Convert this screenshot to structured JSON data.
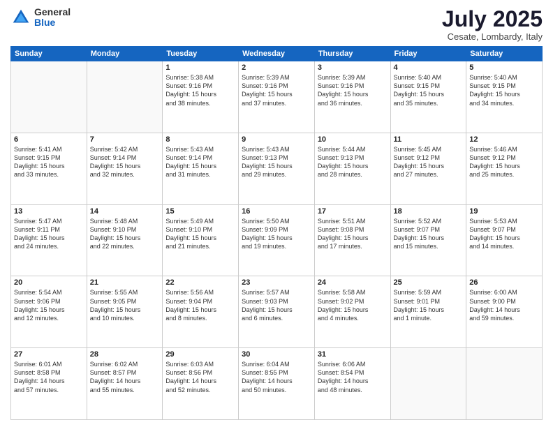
{
  "logo": {
    "general": "General",
    "blue": "Blue"
  },
  "header": {
    "month": "July 2025",
    "location": "Cesate, Lombardy, Italy"
  },
  "weekdays": [
    "Sunday",
    "Monday",
    "Tuesday",
    "Wednesday",
    "Thursday",
    "Friday",
    "Saturday"
  ],
  "weeks": [
    [
      {
        "day": "",
        "info": ""
      },
      {
        "day": "",
        "info": ""
      },
      {
        "day": "1",
        "info": "Sunrise: 5:38 AM\nSunset: 9:16 PM\nDaylight: 15 hours\nand 38 minutes."
      },
      {
        "day": "2",
        "info": "Sunrise: 5:39 AM\nSunset: 9:16 PM\nDaylight: 15 hours\nand 37 minutes."
      },
      {
        "day": "3",
        "info": "Sunrise: 5:39 AM\nSunset: 9:16 PM\nDaylight: 15 hours\nand 36 minutes."
      },
      {
        "day": "4",
        "info": "Sunrise: 5:40 AM\nSunset: 9:15 PM\nDaylight: 15 hours\nand 35 minutes."
      },
      {
        "day": "5",
        "info": "Sunrise: 5:40 AM\nSunset: 9:15 PM\nDaylight: 15 hours\nand 34 minutes."
      }
    ],
    [
      {
        "day": "6",
        "info": "Sunrise: 5:41 AM\nSunset: 9:15 PM\nDaylight: 15 hours\nand 33 minutes."
      },
      {
        "day": "7",
        "info": "Sunrise: 5:42 AM\nSunset: 9:14 PM\nDaylight: 15 hours\nand 32 minutes."
      },
      {
        "day": "8",
        "info": "Sunrise: 5:43 AM\nSunset: 9:14 PM\nDaylight: 15 hours\nand 31 minutes."
      },
      {
        "day": "9",
        "info": "Sunrise: 5:43 AM\nSunset: 9:13 PM\nDaylight: 15 hours\nand 29 minutes."
      },
      {
        "day": "10",
        "info": "Sunrise: 5:44 AM\nSunset: 9:13 PM\nDaylight: 15 hours\nand 28 minutes."
      },
      {
        "day": "11",
        "info": "Sunrise: 5:45 AM\nSunset: 9:12 PM\nDaylight: 15 hours\nand 27 minutes."
      },
      {
        "day": "12",
        "info": "Sunrise: 5:46 AM\nSunset: 9:12 PM\nDaylight: 15 hours\nand 25 minutes."
      }
    ],
    [
      {
        "day": "13",
        "info": "Sunrise: 5:47 AM\nSunset: 9:11 PM\nDaylight: 15 hours\nand 24 minutes."
      },
      {
        "day": "14",
        "info": "Sunrise: 5:48 AM\nSunset: 9:10 PM\nDaylight: 15 hours\nand 22 minutes."
      },
      {
        "day": "15",
        "info": "Sunrise: 5:49 AM\nSunset: 9:10 PM\nDaylight: 15 hours\nand 21 minutes."
      },
      {
        "day": "16",
        "info": "Sunrise: 5:50 AM\nSunset: 9:09 PM\nDaylight: 15 hours\nand 19 minutes."
      },
      {
        "day": "17",
        "info": "Sunrise: 5:51 AM\nSunset: 9:08 PM\nDaylight: 15 hours\nand 17 minutes."
      },
      {
        "day": "18",
        "info": "Sunrise: 5:52 AM\nSunset: 9:07 PM\nDaylight: 15 hours\nand 15 minutes."
      },
      {
        "day": "19",
        "info": "Sunrise: 5:53 AM\nSunset: 9:07 PM\nDaylight: 15 hours\nand 14 minutes."
      }
    ],
    [
      {
        "day": "20",
        "info": "Sunrise: 5:54 AM\nSunset: 9:06 PM\nDaylight: 15 hours\nand 12 minutes."
      },
      {
        "day": "21",
        "info": "Sunrise: 5:55 AM\nSunset: 9:05 PM\nDaylight: 15 hours\nand 10 minutes."
      },
      {
        "day": "22",
        "info": "Sunrise: 5:56 AM\nSunset: 9:04 PM\nDaylight: 15 hours\nand 8 minutes."
      },
      {
        "day": "23",
        "info": "Sunrise: 5:57 AM\nSunset: 9:03 PM\nDaylight: 15 hours\nand 6 minutes."
      },
      {
        "day": "24",
        "info": "Sunrise: 5:58 AM\nSunset: 9:02 PM\nDaylight: 15 hours\nand 4 minutes."
      },
      {
        "day": "25",
        "info": "Sunrise: 5:59 AM\nSunset: 9:01 PM\nDaylight: 15 hours\nand 1 minute."
      },
      {
        "day": "26",
        "info": "Sunrise: 6:00 AM\nSunset: 9:00 PM\nDaylight: 14 hours\nand 59 minutes."
      }
    ],
    [
      {
        "day": "27",
        "info": "Sunrise: 6:01 AM\nSunset: 8:58 PM\nDaylight: 14 hours\nand 57 minutes."
      },
      {
        "day": "28",
        "info": "Sunrise: 6:02 AM\nSunset: 8:57 PM\nDaylight: 14 hours\nand 55 minutes."
      },
      {
        "day": "29",
        "info": "Sunrise: 6:03 AM\nSunset: 8:56 PM\nDaylight: 14 hours\nand 52 minutes."
      },
      {
        "day": "30",
        "info": "Sunrise: 6:04 AM\nSunset: 8:55 PM\nDaylight: 14 hours\nand 50 minutes."
      },
      {
        "day": "31",
        "info": "Sunrise: 6:06 AM\nSunset: 8:54 PM\nDaylight: 14 hours\nand 48 minutes."
      },
      {
        "day": "",
        "info": ""
      },
      {
        "day": "",
        "info": ""
      }
    ]
  ]
}
